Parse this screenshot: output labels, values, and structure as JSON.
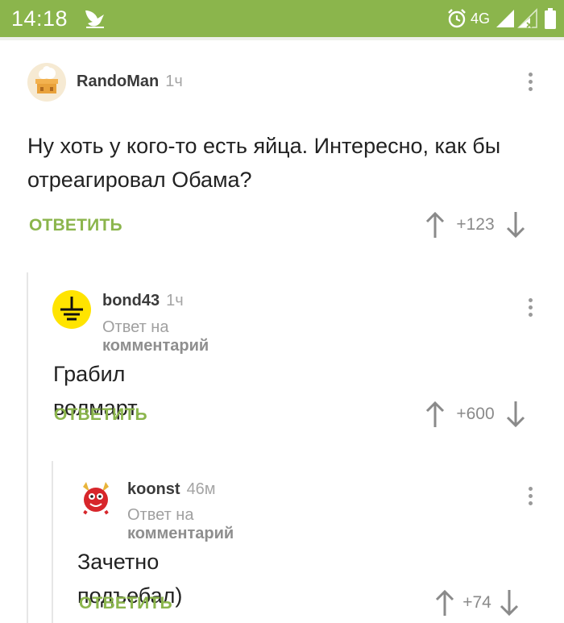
{
  "status_bar": {
    "time": "14:18",
    "network": "4G"
  },
  "comments": [
    {
      "author": "RandoMan",
      "age": "1ч",
      "text": "Ну хоть у кого-то есть яйца. Интересно, как бы отреагировал Обама?",
      "reply_label": "ОТВЕТИТЬ",
      "score": "+123"
    },
    {
      "author": "bond43",
      "age": "1ч",
      "reply_prefix": "Ответ на",
      "reply_target": "комментарий",
      "text": "Грабил волмарт.",
      "reply_label": "ОТВЕТИТЬ",
      "score": "+600"
    },
    {
      "author": "koonst",
      "age": "46м",
      "reply_prefix": "Ответ на",
      "reply_target": "комментарий",
      "text": "Зачетно подъебал)",
      "reply_label": "ОТВЕТИТЬ",
      "score": "+74"
    }
  ],
  "colors": {
    "accent": "#8bb54c",
    "status_bar": "#8bb54c"
  },
  "icons": [
    "app-bird-icon",
    "alarm-icon",
    "signal-icon",
    "battery-icon",
    "more-vert-icon",
    "arrow-up-icon",
    "arrow-down-icon"
  ]
}
